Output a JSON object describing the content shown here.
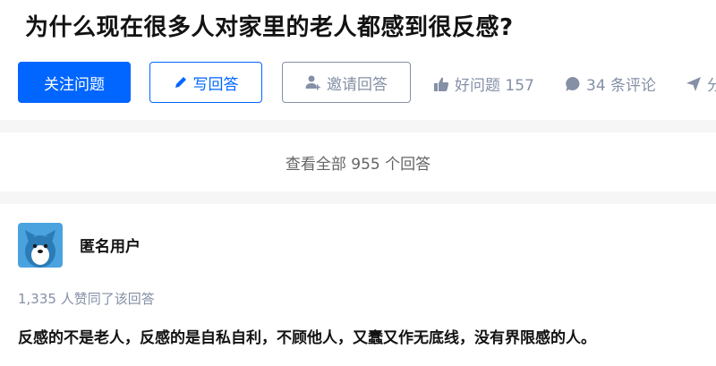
{
  "question": {
    "title": "为什么现在很多人对家里的老人都感到很反感?",
    "buttons": {
      "follow": "关注问题",
      "write_answer": "写回答",
      "invite_answer": "邀请回答"
    },
    "actions": {
      "good_question": "好问题 157",
      "comments": "34 条评论",
      "share": "分"
    },
    "colors": {
      "primary": "#0066ff",
      "muted": "#8590a6"
    },
    "icons": [
      "pencil-icon",
      "invite-user-icon",
      "thumbs-up-icon",
      "comment-bubble-icon",
      "paper-plane-icon"
    ]
  },
  "view_all": {
    "label": "查看全部 955 个回答"
  },
  "answer": {
    "author": {
      "name": "匿名用户",
      "avatar_icon": "anonymous-avatar"
    },
    "votes": "1,335 人赞同了该回答",
    "content": "反感的不是老人，反感的是自私自利，不顾他人，又蠢又作无底线，没有界限感的人。"
  }
}
